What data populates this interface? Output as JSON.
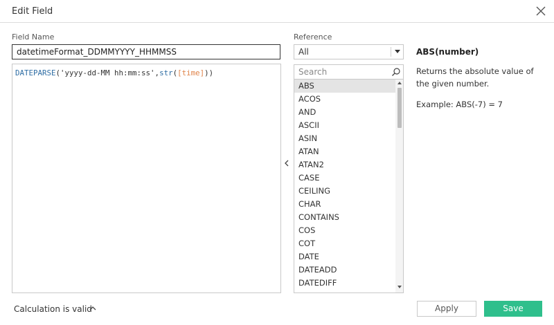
{
  "dialog": {
    "title": "Edit Field"
  },
  "field": {
    "label": "Field Name",
    "value": "datetimeFormat_DDMMYYYY_HHMMSS"
  },
  "formula": {
    "fn1": "DATEPARSE",
    "part1": "('",
    "string": "yyyy-dd-MM hh:mm:ss",
    "part2": "',",
    "fn2": "str",
    "part3": "(",
    "field": "[time]",
    "part4": "))"
  },
  "reference": {
    "label": "Reference",
    "selected": "All",
    "search_placeholder": "Search",
    "functions": [
      "ABS",
      "ACOS",
      "AND",
      "ASCII",
      "ASIN",
      "ATAN",
      "ATAN2",
      "CASE",
      "CEILING",
      "CHAR",
      "CONTAINS",
      "COS",
      "COT",
      "DATE",
      "DATEADD",
      "DATEDIFF"
    ],
    "selected_function": "ABS"
  },
  "description": {
    "signature": "ABS(number)",
    "body": "Returns the absolute value of the given number.",
    "example": "Example: ABS(-7) = 7"
  },
  "footer": {
    "status": "Calculation is valid",
    "apply_label": "Apply",
    "save_label": "Save"
  },
  "colors": {
    "accent": "#2fbf8c",
    "function_token": "#2e6da4",
    "field_token": "#e0844a",
    "selected_row": "#e4e4e4"
  },
  "icons": [
    "close-icon",
    "search-icon",
    "chevron-left-icon",
    "chevron-up-icon",
    "caret-down-icon"
  ]
}
